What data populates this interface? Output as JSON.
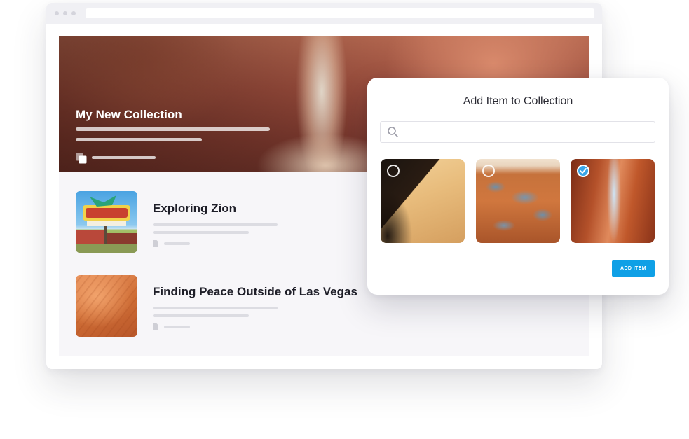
{
  "collection": {
    "title": "My New Collection"
  },
  "cards": [
    {
      "title": "Exploring Zion",
      "image": "thunderbird-restaurant-sign-photo"
    },
    {
      "title": "Finding Peace Outside of Las Vegas",
      "image": "orange-sandstone-texture-photo"
    }
  ],
  "modal": {
    "title": "Add Item to Collection",
    "search_placeholder": "",
    "items": [
      {
        "image": "sand-dune-shadow-photo",
        "selected": false
      },
      {
        "image": "aerial-desert-pools-photo",
        "selected": false
      },
      {
        "image": "slot-canyon-sky-photo",
        "selected": true
      }
    ],
    "add_button_label": "ADD ITEM"
  },
  "colors": {
    "accent": "#0fa0e6",
    "check": "#3aa6e8",
    "content_bg": "#f7f6f9"
  },
  "icons": {
    "search": "search-icon",
    "copy": "copy-icon",
    "document": "document-icon",
    "check": "check-icon"
  }
}
